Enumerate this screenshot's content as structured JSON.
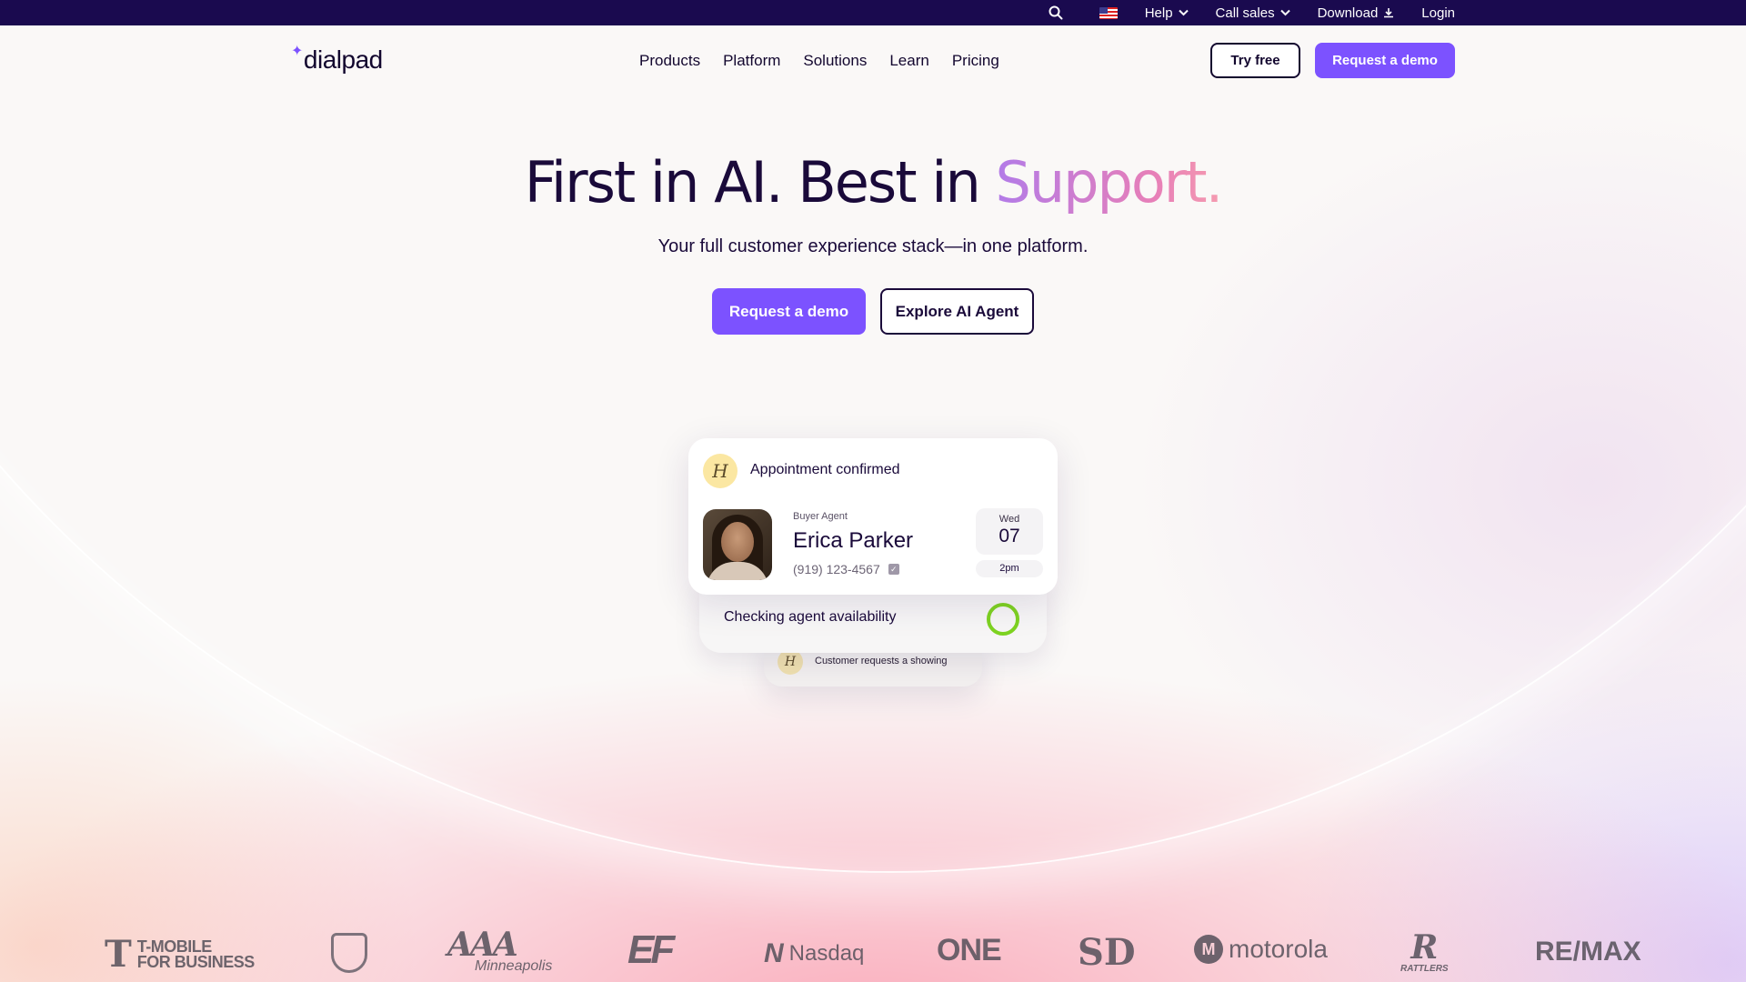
{
  "utility_bar": {
    "help": "Help",
    "call_sales": "Call sales",
    "download": "Download",
    "login": "Login"
  },
  "header": {
    "logo_text": "dialpad",
    "nav": [
      "Products",
      "Platform",
      "Solutions",
      "Learn",
      "Pricing"
    ],
    "try_free": "Try free",
    "request_demo": "Request a demo"
  },
  "hero": {
    "title_main": "First in AI. Best in ",
    "title_accent": "Support.",
    "subtitle": "Your full customer experience stack—in one platform.",
    "cta_primary": "Request a demo",
    "cta_secondary": "Explore AI Agent"
  },
  "appointment_card": {
    "logo_letter": "H",
    "title": "Appointment confirmed",
    "role": "Buyer Agent",
    "name": "Erica Parker",
    "phone": "(919) 123-4567",
    "day": "Wed",
    "date": "07",
    "time": "2pm"
  },
  "status_card": {
    "label": "Checking agent availability",
    "ring_color": "#7ed321"
  },
  "request_card": {
    "logo_letter": "H",
    "label": "Customer requests a showing"
  },
  "customer_logos": {
    "tmobile_t": "T",
    "tmobile_line1": "T-MOBILE",
    "tmobile_line2": "FOR BUSINESS",
    "aaa": "AAA",
    "aaa_city": "Minneapolis",
    "ef": "EF",
    "nasdaq": "Nasdaq",
    "one": "ONE",
    "sd": "SD",
    "motorola": "motorola",
    "rattlers": "RATTLERS",
    "remax": "RE/MAX"
  },
  "colors": {
    "brand_purple": "#7c52ff",
    "utility_bg": "#1a0a4f",
    "text_dark": "#1a0a3a"
  }
}
